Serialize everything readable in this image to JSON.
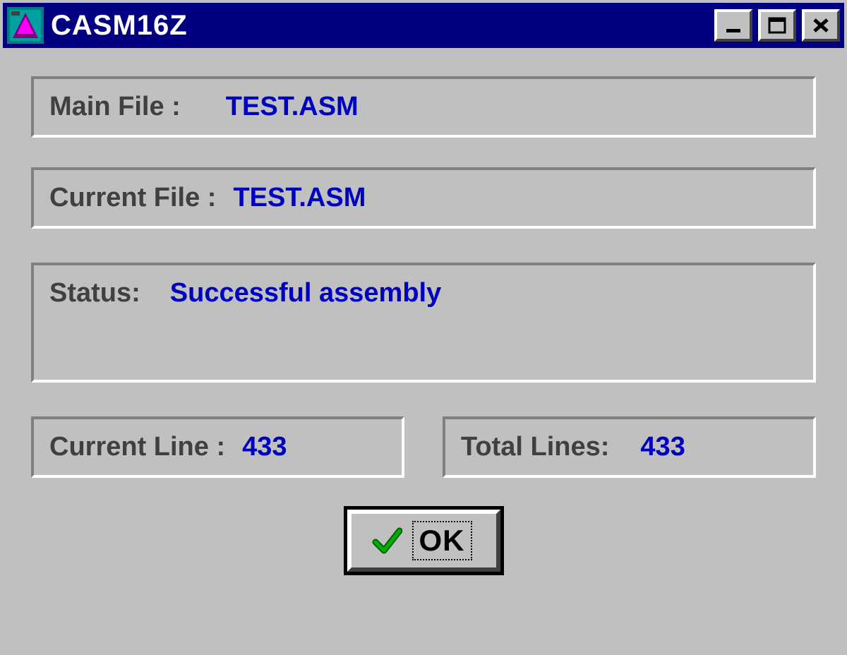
{
  "window": {
    "title": "CASM16Z"
  },
  "panels": {
    "main_file": {
      "label": "Main File :",
      "value": "TEST.ASM"
    },
    "current_file": {
      "label": "Current File :",
      "value": "TEST.ASM"
    },
    "status": {
      "label": "Status:",
      "value": "Successful assembly"
    },
    "current_line": {
      "label": "Current Line :",
      "value": "433"
    },
    "total_lines": {
      "label": "Total Lines:",
      "value": "433"
    }
  },
  "buttons": {
    "ok": "OK"
  },
  "colors": {
    "titlebar_bg": "#000080",
    "window_bg": "#c0c0c0",
    "value_text": "#0000c0",
    "label_text": "#404040"
  }
}
